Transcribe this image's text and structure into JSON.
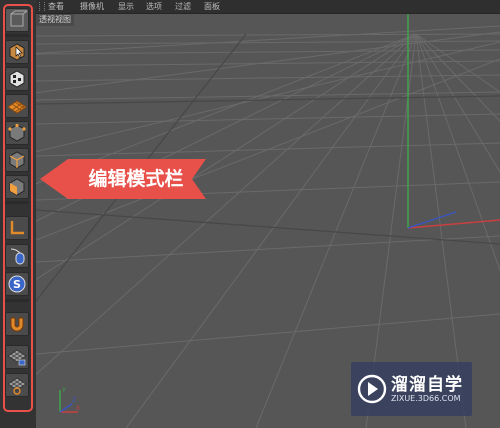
{
  "menu_bar": {
    "items": [
      "查看",
      "摄像机",
      "显示",
      "选项",
      "过滤",
      "面板"
    ]
  },
  "viewport": {
    "label": "透视视图",
    "colors": {
      "background": "#565656",
      "grid_line": "#6a6a6a",
      "axis_y": "#3fa84a",
      "axis_x": "#c84040",
      "axis_z": "#3a55c8"
    },
    "axis_gizmo": {
      "y": "Y",
      "x": "X",
      "z": "Z"
    }
  },
  "sidebar": {
    "tools": [
      {
        "icon": "cube-cursor-icon"
      },
      {
        "icon": "checker-cube-icon"
      },
      {
        "icon": "orange-texture-grid-icon"
      },
      {
        "icon": "point-mode-cube-icon"
      },
      {
        "icon": "edge-mode-cube-icon"
      },
      {
        "icon": "polygon-mode-cube-icon"
      },
      {
        "icon": "axis-corner-icon"
      },
      {
        "icon": "tweak-mouse-icon"
      },
      {
        "icon": "snap-s-icon"
      },
      {
        "icon": "magnet-icon"
      },
      {
        "icon": "workplane-lock-icon"
      },
      {
        "icon": "workplane-cycle-icon"
      }
    ],
    "highlight_color": "#e8504a"
  },
  "callout": {
    "text": "编辑模式栏",
    "color": "#e8504a"
  },
  "watermark": {
    "brand": "溜溜自学",
    "url": "ZIXUE.3D66.COM"
  }
}
